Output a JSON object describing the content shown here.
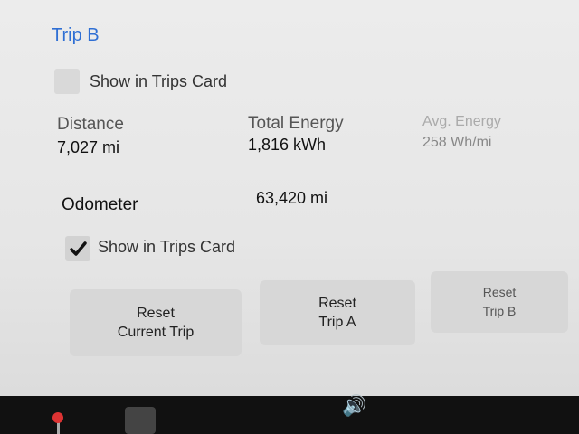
{
  "trip_b": {
    "title": "Trip B",
    "show_in_trips_card": "Show in Trips Card",
    "distance_label": "Distance",
    "distance_value": "7,027 mi",
    "energy_label": "Total Energy",
    "energy_value": "1,816 kWh",
    "avg_label": "Avg. Energy",
    "avg_value": "258 Wh/mi"
  },
  "odometer": {
    "label": "Odometer",
    "value": "63,420 mi",
    "show_in_trips_card": "Show in Trips Card"
  },
  "buttons": {
    "reset_current": "Reset\nCurrent Trip",
    "reset_a": "Reset\nTrip A",
    "reset_b": "Reset\nTrip B"
  },
  "dock": {
    "speaker_icon": "speaker-icon"
  },
  "colors": {
    "accent": "#2f6fd4"
  }
}
